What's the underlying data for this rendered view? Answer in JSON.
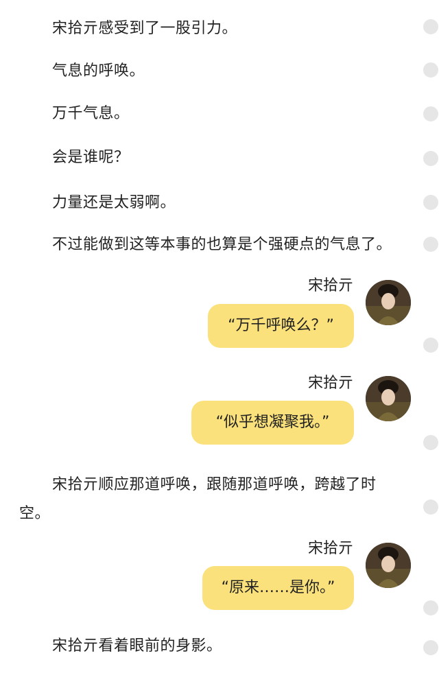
{
  "paragraphs": [
    "宋拾亓感受到了一股引力。",
    "气息的呼唤。",
    "万千气息。",
    "会是谁呢？",
    "力量还是太弱啊。",
    "不过能做到这等本事的也算是个强硬点的气息了。",
    "宋拾亓顺应那道呼唤，跟随那道呼唤，跨越了时空。",
    "宋拾亓看着眼前的身影。"
  ],
  "messages": [
    {
      "speaker": "宋拾亓",
      "text": "“万千呼唤么？”"
    },
    {
      "speaker": "宋拾亓",
      "text": "“似乎想凝聚我。”"
    },
    {
      "speaker": "宋拾亓",
      "text": "“原来……是你。”"
    }
  ],
  "colors": {
    "bubble": "#fbe17b",
    "dot": "#e6e6e6",
    "text": "#222222"
  }
}
